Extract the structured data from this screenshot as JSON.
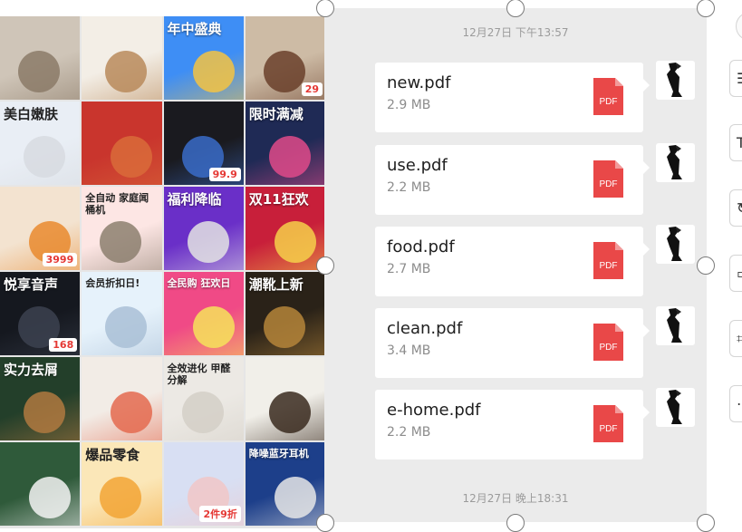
{
  "gallery": {
    "tiles": [
      {
        "caption": "",
        "bg": "#cfc5b8",
        "accent": "#8b7a67",
        "dark": false
      },
      {
        "caption": "",
        "bg": "#f3eee6",
        "accent": "#b98a5a",
        "dark": false
      },
      {
        "caption": "年中盛典",
        "bg": "#3e8ef5",
        "accent": "#f5c342",
        "dark": false
      },
      {
        "caption": "",
        "bg": "#cdbba5",
        "accent": "#6a3f2a",
        "dark": false,
        "price": "29"
      },
      {
        "caption": "美白嫩肤",
        "bg": "#e9eef5",
        "accent": "#d7dbe0",
        "dark": true
      },
      {
        "caption": "",
        "bg": "#c9352d",
        "accent": "#d96b3a",
        "dark": false
      },
      {
        "caption": "",
        "bg": "#1a1a1f",
        "accent": "#3a6cc9",
        "dark": false,
        "price": "99.9"
      },
      {
        "caption": "限时满减",
        "bg": "#1f2a55",
        "accent": "#e04a8a",
        "dark": false
      },
      {
        "caption": "",
        "bg": "#f3e3d0",
        "accent": "#e98a2e",
        "dark": false,
        "price": "3999"
      },
      {
        "caption": "全自动 家庭闻桶机",
        "bg": "#fde6e4",
        "accent": "#8c7f6f",
        "dark": true
      },
      {
        "caption": "福利降临",
        "bg": "#6a2fc8",
        "accent": "#e3e3e3",
        "dark": false
      },
      {
        "caption": "双11狂欢",
        "bg": "#c81f3a",
        "accent": "#f6d04a",
        "dark": false
      },
      {
        "caption": "悦享音声",
        "bg": "#15181f",
        "accent": "#3c4250",
        "dark": false,
        "price": "168"
      },
      {
        "caption": "会员折扣日!",
        "bg": "#e6f2fb",
        "accent": "#a9bfd6",
        "dark": true
      },
      {
        "caption": "全民购 狂欢日",
        "bg": "#f04a86",
        "accent": "#f6e35a",
        "dark": false
      },
      {
        "caption": "潮靴上新",
        "bg": "#2a2218",
        "accent": "#b5853a",
        "dark": false
      },
      {
        "caption": "实力去屑",
        "bg": "#233f2a",
        "accent": "#b07940",
        "dark": false
      },
      {
        "caption": "",
        "bg": "#f2ece6",
        "accent": "#e46a4f",
        "dark": false
      },
      {
        "caption": "全效进化 甲醛分解",
        "bg": "#ece9e4",
        "accent": "#d4cfc7",
        "dark": true
      },
      {
        "caption": "",
        "bg": "#f1efe9",
        "accent": "#3a2a1e",
        "dark": false
      },
      {
        "caption": "",
        "bg": "#2f5a3a",
        "accent": "#f3f3f3",
        "dark": false
      },
      {
        "caption": "爆品零食",
        "bg": "#fbe7b8",
        "accent": "#f2a435",
        "dark": true
      },
      {
        "caption": "",
        "bg": "#d8dff3",
        "accent": "#f1c7c7",
        "dark": false,
        "price": "2件9折"
      },
      {
        "caption": "降噪蓝牙耳机",
        "bg": "#1d3f8a",
        "accent": "#e6e6e6",
        "dark": false
      }
    ]
  },
  "chat": {
    "timestamp_top": "12月27日 下午13:57",
    "timestamp_bottom": "12月27日 晚上18:31",
    "messages": [
      {
        "name": "new.pdf",
        "size": "2.9 MB"
      },
      {
        "name": "use.pdf",
        "size": "2.2 MB"
      },
      {
        "name": "food.pdf",
        "size": "2.7 MB"
      },
      {
        "name": "clean.pdf",
        "size": "3.4 MB"
      },
      {
        "name": "e-home.pdf",
        "size": "2.2 MB"
      }
    ],
    "pdf_icon_label": "PDF"
  },
  "colors": {
    "panel_bg": "#ebebeb",
    "bubble_bg": "#ffffff",
    "pdf_red": "#e94848",
    "timestamp": "#9b9b9b"
  }
}
